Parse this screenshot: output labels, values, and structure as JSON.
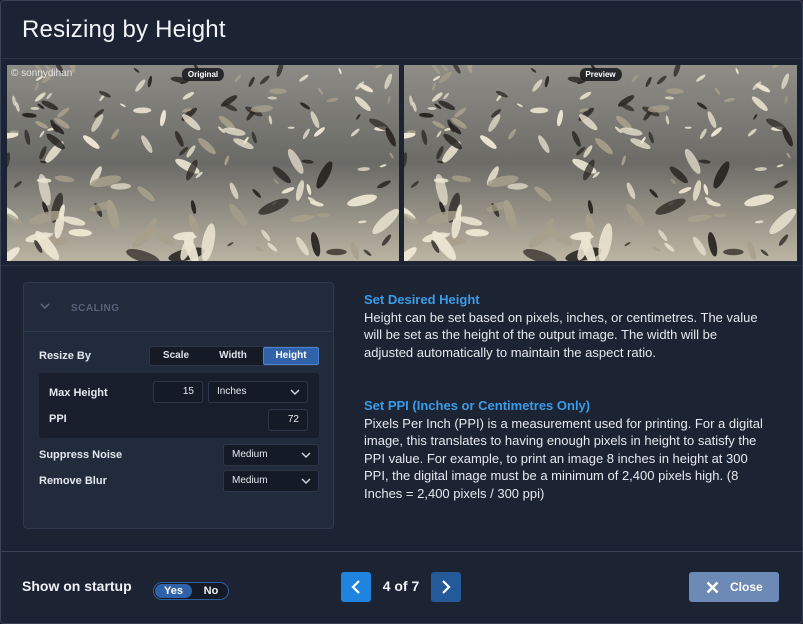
{
  "dialog": {
    "title": "Resizing by Height"
  },
  "images": {
    "original_tag": "Original",
    "preview_tag": "Preview",
    "watermark": "© sonnydihan"
  },
  "scaling": {
    "title": "SCALING",
    "resize_by_label": "Resize By",
    "resize_options": [
      "Scale",
      "Width",
      "Height"
    ],
    "resize_selected": "Height",
    "max_height_label": "Max Height",
    "max_height_value": "15",
    "unit_value": "Inches",
    "ppi_label": "PPI",
    "ppi_value": "72",
    "suppress_noise_label": "Suppress Noise",
    "suppress_noise_value": "Medium",
    "remove_blur_label": "Remove Blur",
    "remove_blur_value": "Medium"
  },
  "description": {
    "h1": "Set Desired Height",
    "p1": "Height can be set based on pixels, inches, or centimetres. The value will be set as the height of the output image. The width will be adjusted automatically to maintain the aspect ratio.",
    "h2": "Set PPI (Inches or Centimetres Only)",
    "p2": "Pixels Per Inch (PPI) is a measurement used for printing. For a digital image, this translates to having enough pixels in height to satisfy the PPI value. For example, to print an image 8 inches in height at 300 PPI, the digital image must be a minimum of 2,400 pixels high. (8 Inches = 2,400 pixels / 300 ppi)"
  },
  "footer": {
    "startup_label": "Show on startup",
    "toggle_yes": "Yes",
    "toggle_no": "No",
    "page_indicator": "4 of 7",
    "close_label": "Close"
  },
  "icons": {
    "chevron": "chevron-down-icon",
    "prev": "chevron-left-icon",
    "next": "chevron-right-icon",
    "close": "x-icon"
  },
  "colors": {
    "accent": "#1f84e0",
    "heading": "#3a9be8",
    "selected": "#2f62a8",
    "close_button": "#6d89b5",
    "background": "#1c2333"
  }
}
